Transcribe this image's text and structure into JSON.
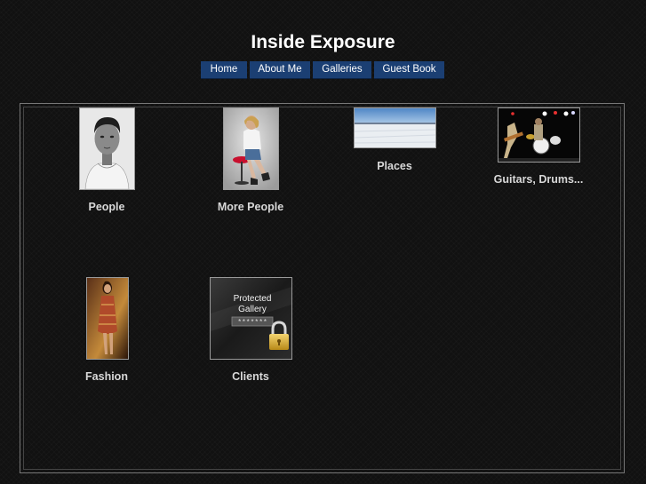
{
  "site": {
    "title": "Inside Exposure"
  },
  "nav": {
    "items": [
      {
        "label": "Home"
      },
      {
        "label": "About Me"
      },
      {
        "label": "Galleries"
      },
      {
        "label": "Guest Book"
      }
    ]
  },
  "galleries": [
    {
      "caption": "People"
    },
    {
      "caption": "More People"
    },
    {
      "caption": "Places"
    },
    {
      "caption": "Guitars, Drums..."
    },
    {
      "caption": "Fashion"
    },
    {
      "caption": "Clients",
      "lock_text_line1": "Protected",
      "lock_text_line2": "Gallery",
      "lock_password_mask": "*******"
    }
  ],
  "colors": {
    "background": "#111111",
    "nav_button": "#1b3f73",
    "caption": "#d8d8d8"
  }
}
